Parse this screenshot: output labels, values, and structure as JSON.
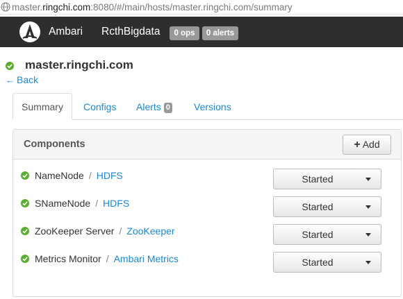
{
  "url": {
    "scheme_prefix": "master.",
    "host": "ringchi.com",
    "rest": ":8080/#/main/hosts/master.ringchi.com/summary"
  },
  "nav": {
    "brand": "Ambari",
    "cluster": "RcthBigdata",
    "ops_badge": "0 ops",
    "alerts_badge": "0 alerts"
  },
  "host": {
    "name": "master.ringchi.com",
    "back_label": "Back",
    "status_color": "#5aad2c"
  },
  "tabs": [
    {
      "label": "Summary",
      "active": true
    },
    {
      "label": "Configs"
    },
    {
      "label": "Alerts",
      "badge": "0"
    },
    {
      "label": "Versions"
    }
  ],
  "components": {
    "title": "Components",
    "add_label": "Add",
    "rows": [
      {
        "name": "NameNode",
        "service": "HDFS",
        "state": "Started"
      },
      {
        "name": "SNameNode",
        "service": "HDFS",
        "state": "Started"
      },
      {
        "name": "ZooKeeper Server",
        "service": "ZooKeeper",
        "state": "Started"
      },
      {
        "name": "Metrics Monitor",
        "service": "Ambari Metrics",
        "state": "Started"
      }
    ]
  },
  "colors": {
    "link": "#1a8ad4",
    "nav_bg": "#2e2e2e",
    "ok": "#5aad2c"
  }
}
